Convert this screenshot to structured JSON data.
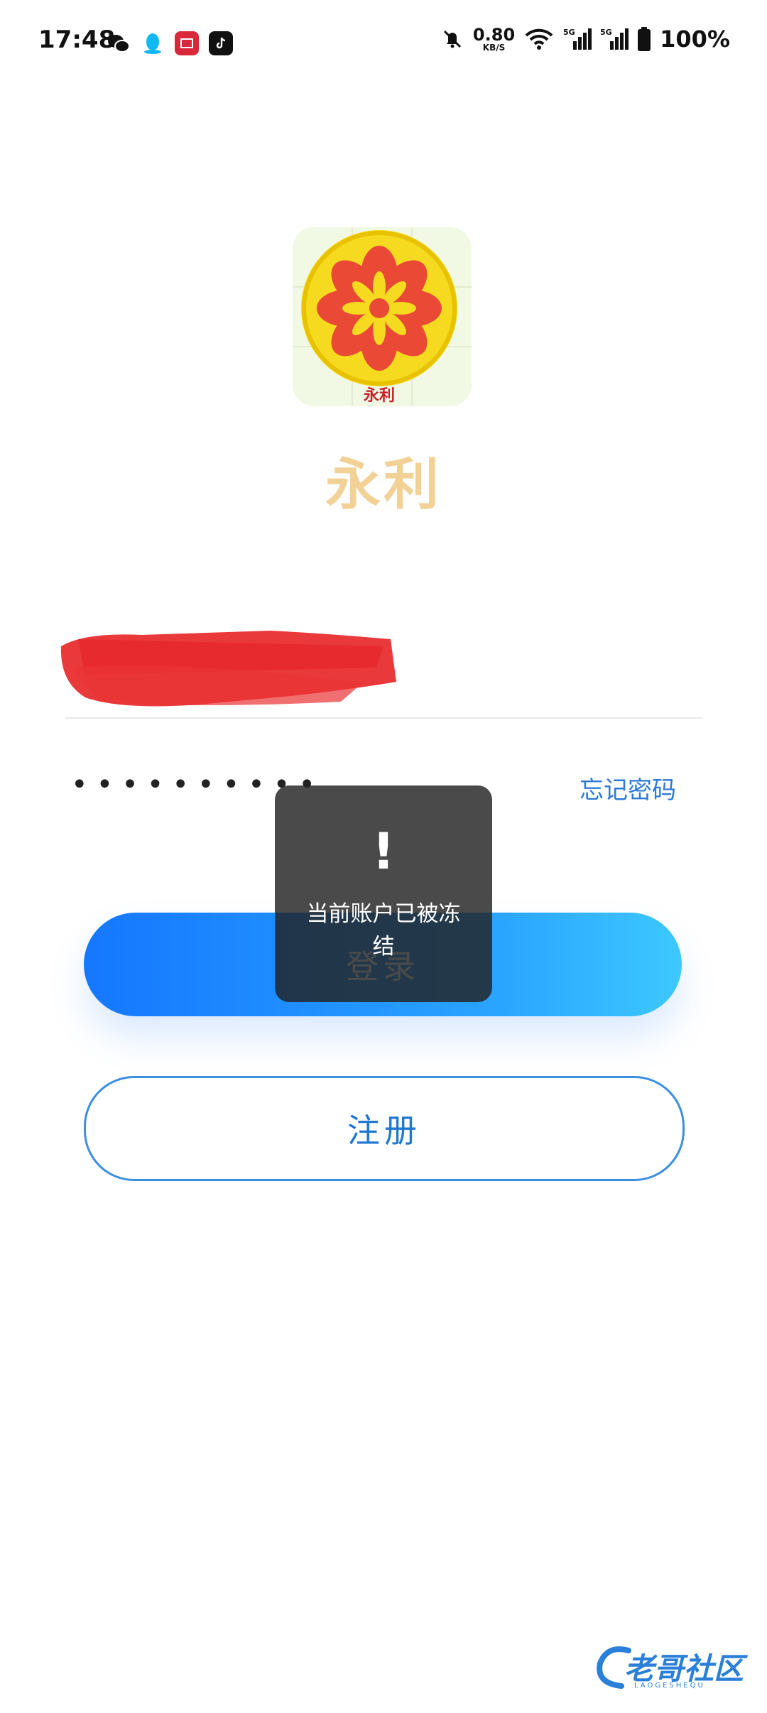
{
  "status_bar": {
    "time": "17:48",
    "notification_icons": [
      "wechat-icon",
      "qq-icon",
      "app-red-icon",
      "tiktok-icon"
    ],
    "network_speed_value": "0.80",
    "network_speed_unit": "KB/S",
    "battery_percent": "100%"
  },
  "app": {
    "logo_caption": "永利",
    "name": "永利"
  },
  "form": {
    "password_mask": "••••••••••",
    "forgot_password": "忘记密码",
    "login_label": "登录",
    "register_label": "注册"
  },
  "toast": {
    "icon": "!",
    "message": "当前账户已被冻结"
  },
  "watermark": {
    "text": "老哥社区",
    "subtext": "LAOGESHEQU"
  },
  "colors": {
    "accent_blue": "#1577ff",
    "link_blue": "#2e79d6",
    "app_name_gold": "#f2d196",
    "redaction_red": "#e8282a"
  }
}
